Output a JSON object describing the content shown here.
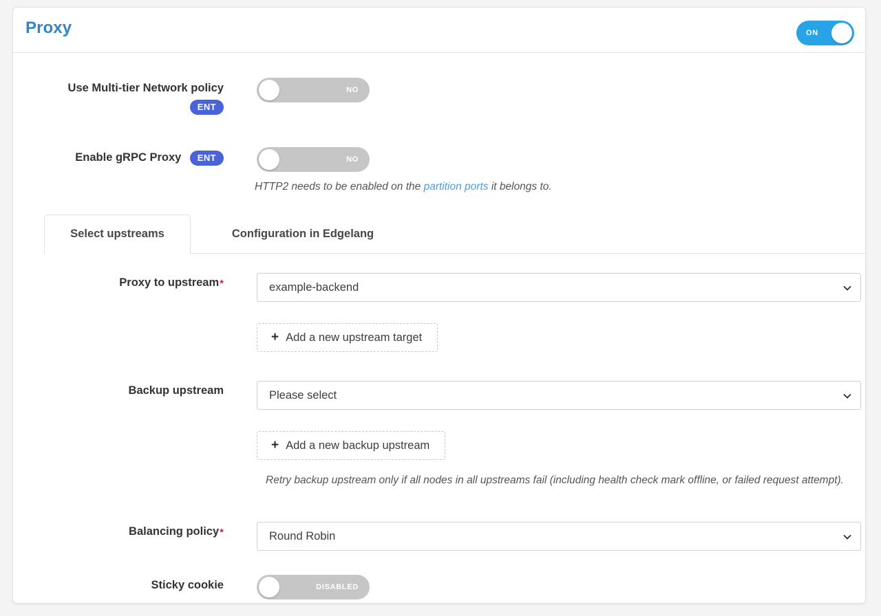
{
  "card": {
    "title": "Proxy",
    "master_toggle": {
      "name": "proxy-enable-toggle",
      "state_label": "ON",
      "on": true,
      "color": "#27a3e8"
    }
  },
  "fields": {
    "multi_tier": {
      "label": "Use Multi-tier Network policy",
      "badge": "ENT",
      "toggle_label": "NO",
      "on": false
    },
    "grpc": {
      "label": "Enable gRPC Proxy",
      "badge": "ENT",
      "toggle_label": "NO",
      "on": false,
      "hint_prefix": "HTTP2 needs to be enabled on the ",
      "hint_link": "partition ports",
      "hint_suffix": " it belongs to."
    },
    "proxy_to_upstream": {
      "label": "Proxy to upstream",
      "required": "*",
      "value": "example-backend",
      "add_button": "Add a new upstream target",
      "plus": "+"
    },
    "backup_upstream": {
      "label": "Backup upstream",
      "value": "Please select",
      "add_button": "Add a new backup upstream",
      "plus": "+",
      "hint": "Retry backup upstream only if all nodes in all upstreams fail (including health check mark offline, or failed request attempt)."
    },
    "balancing_policy": {
      "label": "Balancing policy",
      "required": "*",
      "value": "Round Robin"
    },
    "sticky_cookie": {
      "label": "Sticky cookie",
      "toggle_label": "DISABLED",
      "on": false
    }
  },
  "tabs": [
    {
      "label": "Select upstreams",
      "active": true
    },
    {
      "label": "Configuration in Edgelang",
      "active": false
    }
  ],
  "colors": {
    "title": "#3185c8",
    "badge": "#4a63d8",
    "toggle_on": "#27a3e8",
    "toggle_off": "#c6c6c6",
    "required": "#e8192c",
    "link": "#4a9fe0"
  }
}
